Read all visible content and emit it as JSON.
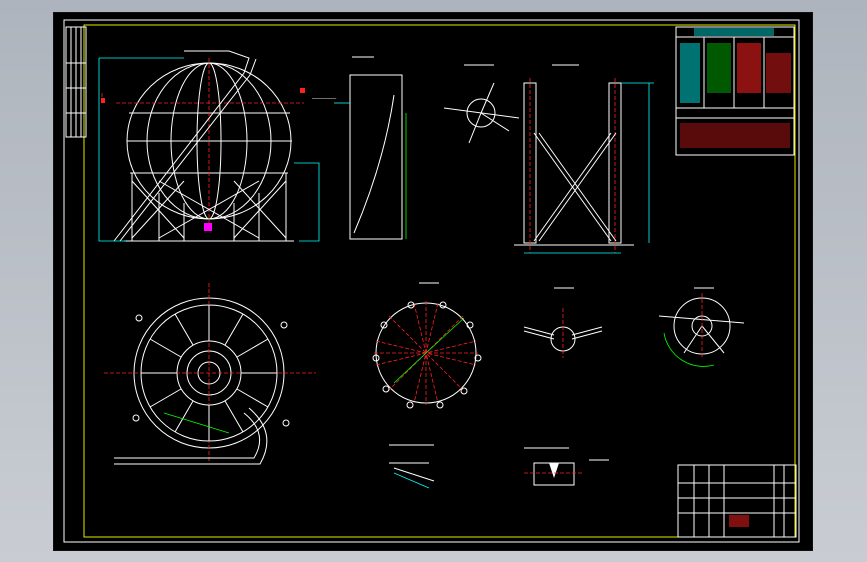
{
  "viewport": {
    "background": "#000000",
    "frame_color": "#ffff00"
  },
  "colors": {
    "white": "#ffffff",
    "cyan": "#00ffff",
    "green": "#00ff00",
    "red": "#ff2020",
    "magenta": "#ff00ff",
    "yellow": "#ffff00"
  },
  "icons": [
    "sphere-tank-elevation",
    "sphere-tank-plan",
    "support-detail",
    "section-view",
    "title-block"
  ]
}
